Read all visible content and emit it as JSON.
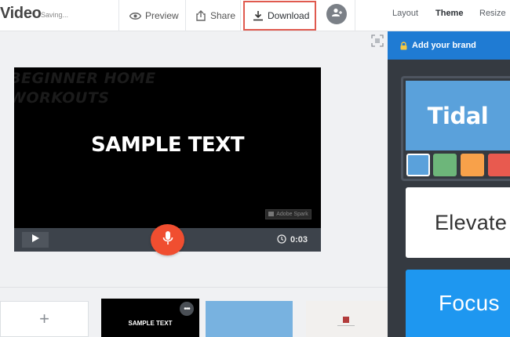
{
  "header": {
    "app_title": "Video",
    "status": "Saving...",
    "preview_label": "Preview",
    "share_label": "Share",
    "download_label": "Download"
  },
  "tabs": [
    {
      "label": "Layout",
      "active": false
    },
    {
      "label": "Theme",
      "active": true
    },
    {
      "label": "Resize",
      "active": false
    }
  ],
  "video": {
    "overlay_title": "BEGINNER HOME\nWORKOUTS",
    "sample_text": "SAMPLE TEXT",
    "watermark": "Adobe Spark",
    "duration": "0:03"
  },
  "slides": [
    {
      "kind": "add",
      "label": "+"
    },
    {
      "kind": "text",
      "label": "SAMPLE TEXT",
      "more_label": "•••"
    },
    {
      "kind": "image",
      "color": "#78b2e0"
    },
    {
      "kind": "image",
      "color": "#f2f0ee"
    }
  ],
  "theme_panel": {
    "add_brand_label": "Add your brand",
    "themes": [
      {
        "name": "Tidal",
        "color": "#5aa1db",
        "selected": true,
        "swatches": [
          "#5aa1db",
          "#6db67a",
          "#f8a14a",
          "#e85a4f"
        ]
      },
      {
        "name": "Elevate",
        "color": "#ffffff",
        "selected": false
      },
      {
        "name": "Focus",
        "color": "#1e97f0",
        "selected": false
      }
    ]
  },
  "colors": {
    "accent": "#1f7bd3",
    "record": "#f04e30",
    "highlight": "#e05a4f"
  }
}
